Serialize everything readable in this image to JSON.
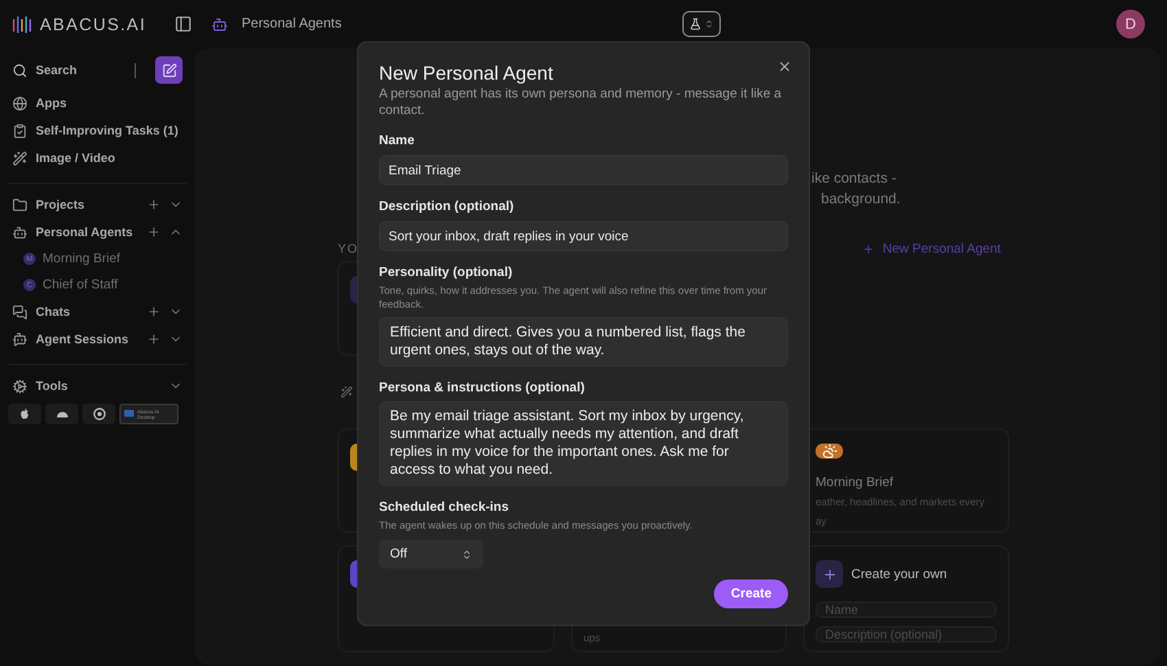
{
  "topbar": {
    "logo": "ABACUS.AI",
    "breadcrumb": "Personal Agents",
    "avatar": "D"
  },
  "sidebar": {
    "search": "Search",
    "links": [
      {
        "label": "Apps"
      },
      {
        "label": "Self-Improving Tasks (1)"
      },
      {
        "label": "Image / Video"
      }
    ],
    "sections": [
      {
        "label": "Projects",
        "expanded": false
      },
      {
        "label": "Personal Agents",
        "expanded": true,
        "children": [
          {
            "initial": "M",
            "label": "Morning Brief"
          },
          {
            "initial": "C",
            "label": "Chief of Staff"
          }
        ]
      },
      {
        "label": "Chats",
        "expanded": false
      },
      {
        "label": "Agent Sessions",
        "expanded": false
      }
    ],
    "tools": {
      "label": "Tools",
      "expanded": false,
      "apps": [
        {
          "kind": "apple"
        },
        {
          "kind": "android"
        },
        {
          "kind": "chrome"
        },
        {
          "kind": "desktop",
          "line1": "Abacus AI",
          "line2": "Desktop"
        }
      ]
    }
  },
  "main": {
    "hero_lines": [
      "ike contacts -",
      "background."
    ],
    "section_label": "YO",
    "new_button": "New Personal Agent",
    "your_agents": [
      {
        "kind": "agent"
      }
    ],
    "template_rows": [
      {
        "cards": [
          {
            "kind": "template",
            "color": "#b8861b"
          },
          {
            "kind": "template",
            "color": "#c2702a",
            "title": "Morning Brief",
            "lines": [
              "eather, headlines, and markets every",
              "ay"
            ]
          }
        ]
      },
      {
        "cards": [
          {
            "kind": "template",
            "color": "#5b46c9"
          },
          {
            "kind": "template",
            "lines": [
              "ups"
            ]
          },
          {
            "kind": "create",
            "title": "Create your own",
            "placeholders": [
              "Name",
              "Description (optional)"
            ]
          }
        ]
      }
    ]
  },
  "modal": {
    "title": "New Personal Agent",
    "subtitle": "A personal agent has its own persona and memory - message it like a contact.",
    "fields": [
      {
        "kind": "input",
        "label": "Name",
        "value": "Email Triage"
      },
      {
        "kind": "input",
        "label": "Description (optional)",
        "value": "Sort your inbox, draft replies in your voice"
      },
      {
        "kind": "textarea",
        "label": "Personality (optional)",
        "help": "Tone, quirks, how it addresses you. The agent will also refine this over time from your feedback.",
        "value": "Efficient and direct. Gives you a numbered list, flags the urgent ones, stays out of the way."
      },
      {
        "kind": "textarea",
        "label": "Persona & instructions (optional)",
        "value": "Be my email triage assistant. Sort my inbox by urgency, summarize what actually needs my attention, and draft replies in my voice for the important ones. Ask me for access to what you need."
      },
      {
        "kind": "select",
        "label": "Scheduled check-ins",
        "help": "The agent wakes up on this schedule and messages you proactively.",
        "value": "Off"
      }
    ],
    "submit": "Create"
  }
}
